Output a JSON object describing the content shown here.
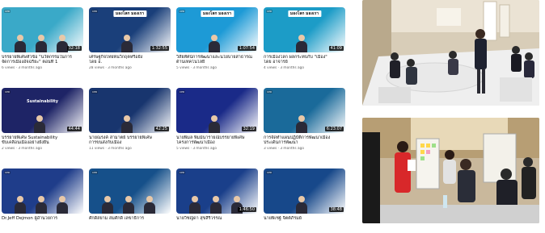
{
  "videos": [
    {
      "line1": "บรรยายพิเศษหัวข้อ \"นวัตกรรมในการ",
      "line2": "จัดการเมืองอัจฉริยะ\" ตอนที่ 1",
      "meta": "6 views · 3 months ago",
      "duration": "32:18",
      "logo": "CPD",
      "thumb_text": "",
      "banner": ""
    },
    {
      "line1": "เศรษฐกิจไทยพ้นวิกฤตหรือยัง",
      "line2": "โดย อ.",
      "meta": "28 views · 3 months ago",
      "duration": "1:32:55",
      "logo": "CPD",
      "thumb_text": "",
      "banner": "มองโลก มองเรา"
    },
    {
      "line1": "วิสัยทัศน์การพัฒนาและนโยบายสาธารณ",
      "line2": "ด้านเทคโนโลยี",
      "meta": "5 views · 3 months ago",
      "duration": "1:07:54",
      "logo": "CPD",
      "thumb_text": "",
      "banner": "มองโลก มองเรา"
    },
    {
      "line1": "การเมืองโลก ผลกระทบกับ \"เมือง\"",
      "line2": "โดย อาจารย์",
      "meta": "4 views · 3 months ago",
      "duration": "41:09",
      "logo": "CPD",
      "thumb_text": "",
      "banner": "มองโลก มองเรา"
    },
    {
      "line1": "บรรยายพิเศษ Sustainability",
      "line2": "ขับเคลื่อนเมืองอย่างยั่งยืน",
      "meta": "2 views · 3 months ago",
      "duration": "44:44",
      "logo": "CPD",
      "thumb_text": "Sustainability",
      "banner": ""
    },
    {
      "line1": "นายณรงค์ สามาตย์ บรรยายพิเศษ",
      "line2": "การขนส่งกับเมือง",
      "meta": "11 views · 3 months ago",
      "duration": "42:25",
      "logo": "CPD",
      "thumb_text": "",
      "banner": ""
    },
    {
      "line1": "นายพิมล พิมม์นารายณ์บรรยายพิเศษ",
      "line2": "โครงการพัฒนาเมือง",
      "meta": "5 views · 3 months ago",
      "duration": "32:19",
      "logo": "CPD",
      "thumb_text": "",
      "banner": ""
    },
    {
      "line1": "การจัดทำแผนปฏิบัติการพัฒนาเมือง",
      "line2": "ประเด็นการพัฒนา",
      "meta": "3 views · 3 months ago",
      "duration": "6:23:07",
      "logo": "CPD",
      "thumb_text": "",
      "banner": ""
    },
    {
      "line1": "Dr.Jeff Dejmon ผู้อำนวยการ",
      "line2": "",
      "meta": "",
      "duration": "",
      "logo": "CPD",
      "thumb_text": "",
      "banner": ""
    },
    {
      "line1": "ศักดิ์สยาม สมศักดิ์ เลขาธิการ",
      "line2": "",
      "meta": "",
      "duration": "",
      "logo": "CPD",
      "thumb_text": "",
      "banner": ""
    },
    {
      "line1": "นายวิชญ์ดา สุขสิริวรรณ",
      "line2": "",
      "meta": "",
      "duration": "1:46:50",
      "logo": "CPD",
      "thumb_text": "",
      "banner": ""
    },
    {
      "line1": "นายพิเชฐ์ จิตต์ภิรมย์",
      "line2": "",
      "meta": "",
      "duration": "38:48",
      "logo": "CPD",
      "thumb_text": "",
      "banner": ""
    }
  ],
  "thumb_colors": [
    "#3aa9c8",
    "#1a3f7a",
    "#1d9ad6",
    "#1c9cc7",
    "#1e2466",
    "#18356e",
    "#1a2a88",
    "#1a6a9a",
    "#1f3d8a",
    "#16508a",
    "#1a3f8a",
    "#17488a"
  ],
  "photos": {
    "top_alt": "",
    "bottom_alt": ""
  }
}
